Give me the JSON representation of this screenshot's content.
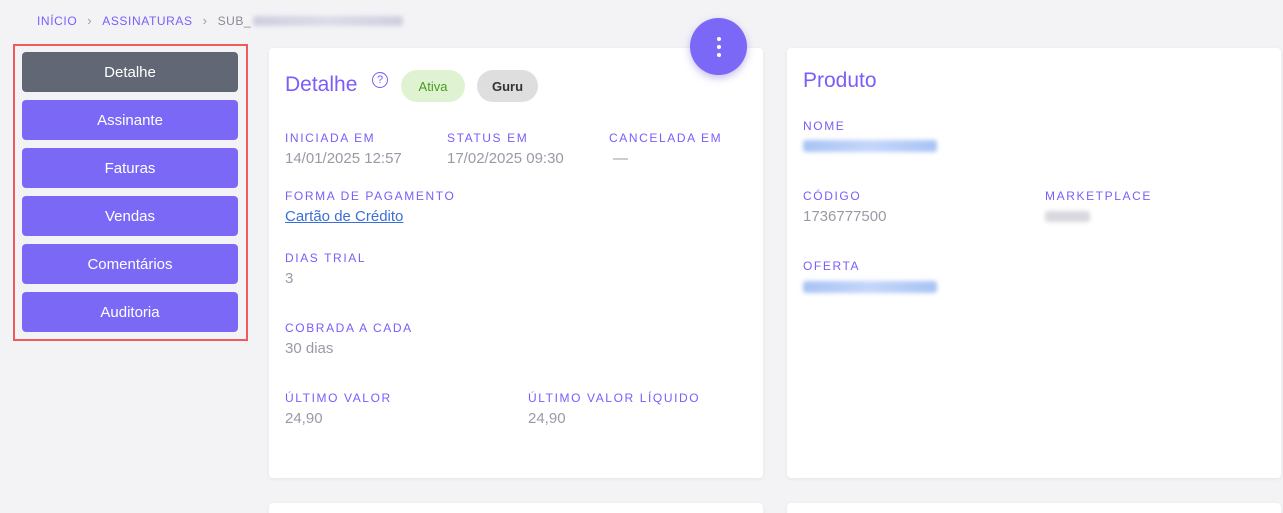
{
  "breadcrumb": {
    "home": "INÍCIO",
    "section": "ASSINATURAS",
    "current_prefix": "SUB_"
  },
  "nav": {
    "items": [
      "Detalhe",
      "Assinante",
      "Faturas",
      "Vendas",
      "Comentários",
      "Auditoria"
    ],
    "active": "Detalhe"
  },
  "fab": {
    "icon": "more-vertical-icon"
  },
  "detail": {
    "title": "Detalhe",
    "help_icon": "?",
    "status_badge": "Ativa",
    "platform_badge": "Guru",
    "started_label": "INICIADA EM",
    "started_value": "14/01/2025 12:57",
    "status_label": "STATUS EM",
    "status_value": "17/02/2025 09:30",
    "canceled_label": "CANCELADA EM",
    "canceled_value": "—",
    "payment_label": "FORMA DE PAGAMENTO",
    "payment_value": "Cartão de Crédito",
    "trial_label": "DIAS TRIAL",
    "trial_value": "3",
    "charged_label": "COBRADA A CADA",
    "charged_value": "30 dias",
    "last_value_label": "ÚLTIMO VALOR",
    "last_value": "24,90",
    "last_net_label": "ÚLTIMO VALOR LÍQUIDO",
    "last_net_value": "24,90"
  },
  "product": {
    "title": "Produto",
    "name_label": "NOME",
    "code_label": "CÓDIGO",
    "code_value": "1736777500",
    "marketplace_label": "MARKETPLACE",
    "offer_label": "OFERTA"
  },
  "colors": {
    "accent": "#7b68f6",
    "active_nav": "#616774",
    "highlight_border": "#ef5a5a",
    "badge_green_bg": "#dff3d2",
    "badge_green_text": "#4a9a1f"
  }
}
